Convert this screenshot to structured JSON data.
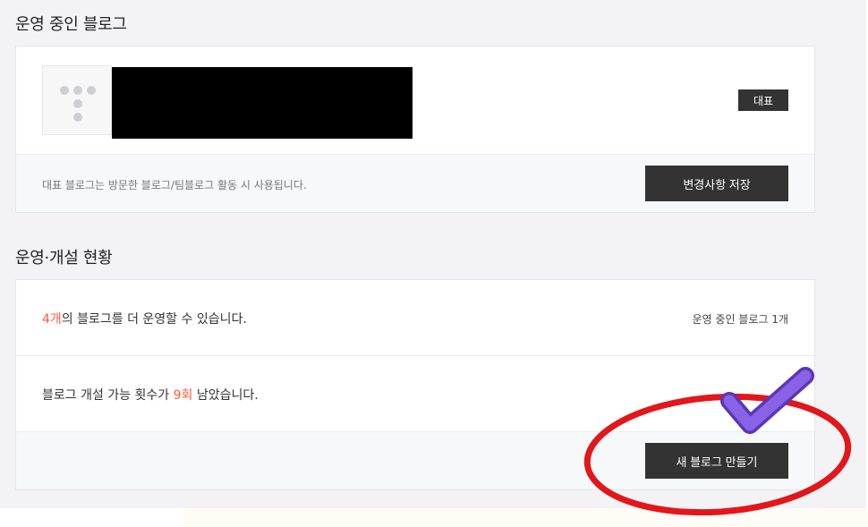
{
  "operating_section": {
    "title": "운영 중인 블로그",
    "badge": "대표",
    "helper_text": "대표 블로그는 방문한 블로그/팀블로그 활동 시 사용됩니다.",
    "save_button": "변경사항 저장"
  },
  "status_section": {
    "title": "운영·개설 현황",
    "line1": {
      "count": "4개",
      "text": "의 블로그를 더 운영할 수 있습니다.",
      "right": "운영 중인 블로그 1개"
    },
    "line2": {
      "prefix": "블로그 개설 가능 횟수가 ",
      "count": "9회",
      "suffix": " 남았습니다."
    },
    "create_button": "새 블로그 만들기"
  },
  "annotations": {
    "circle_color": "#e2161b",
    "check_color": "#7b4fd6"
  }
}
